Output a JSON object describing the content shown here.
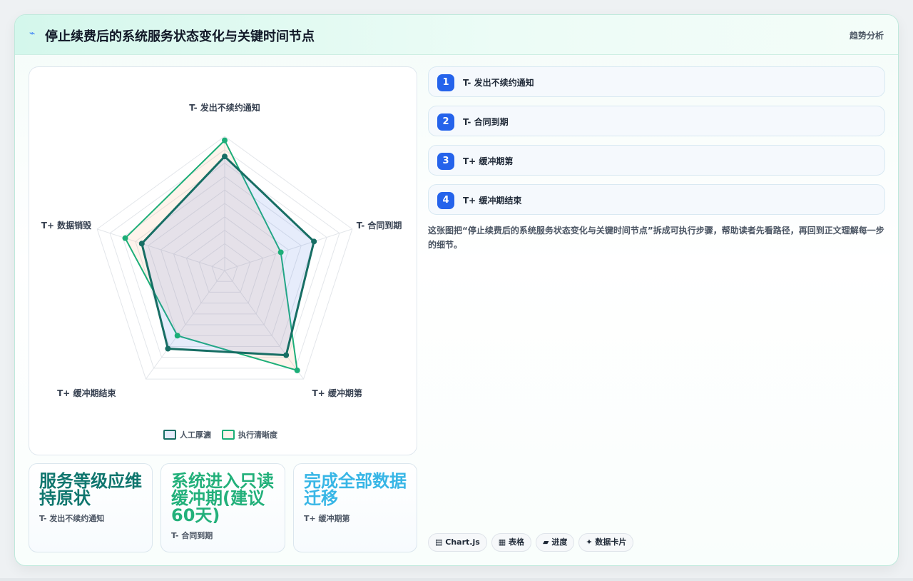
{
  "header": {
    "icon": "bolt-icon",
    "title": "停止续费后的系统服务状态变化与关键时间节点",
    "tag": "趋势分析"
  },
  "chart_data": {
    "type": "radar",
    "categories": [
      "T- 发出不续约通知",
      "T- 合同到期",
      "T+ 缓冲期第",
      "T+ 缓冲期结束",
      "T+ 数据销毁"
    ],
    "scale": [
      0,
      100
    ],
    "rings": 10,
    "series": [
      {
        "name": "人工厚瀌",
        "values": [
          85,
          70,
          78,
          72,
          65
        ],
        "color": "#176e64",
        "fill": "rgba(80,120,230,0.14)"
      },
      {
        "name": "执行清晰度",
        "values": [
          97,
          44,
          92,
          60,
          78
        ],
        "color": "#1cae78",
        "fill": "rgba(248,170,110,0.14)"
      }
    ],
    "legend_position": "bottom"
  },
  "steps": [
    {
      "num": "1",
      "label": "T- 发出不续约通知"
    },
    {
      "num": "2",
      "label": "T- 合同到期"
    },
    {
      "num": "3",
      "label": "T+ 缓冲期第"
    },
    {
      "num": "4",
      "label": "T+ 缓冲期结束"
    }
  ],
  "description": "这张图把“停止续费后的系统服务状态变化与关键时间节点”拆成可执行步骤，帮助读者先看路径，再回到正文理解每一步的细节。",
  "stats": [
    {
      "value": "服务等级应维持原状",
      "sub": "T- 发出不续约通知",
      "color": "#0f766e"
    },
    {
      "value": "系统进入只读缓冲期(建议60天)",
      "sub": "T- 合同到期",
      "color": "#22b07a"
    },
    {
      "value": "完成全部数据迁移",
      "sub": "T+ 缓冲期第",
      "color": "#38b6e6"
    }
  ],
  "pills": [
    {
      "icon": "▤",
      "label": "Chart.js"
    },
    {
      "icon": "▦",
      "label": "表格"
    },
    {
      "icon": "▰",
      "label": "进度"
    },
    {
      "icon": "✦",
      "label": "数据卡片"
    }
  ]
}
